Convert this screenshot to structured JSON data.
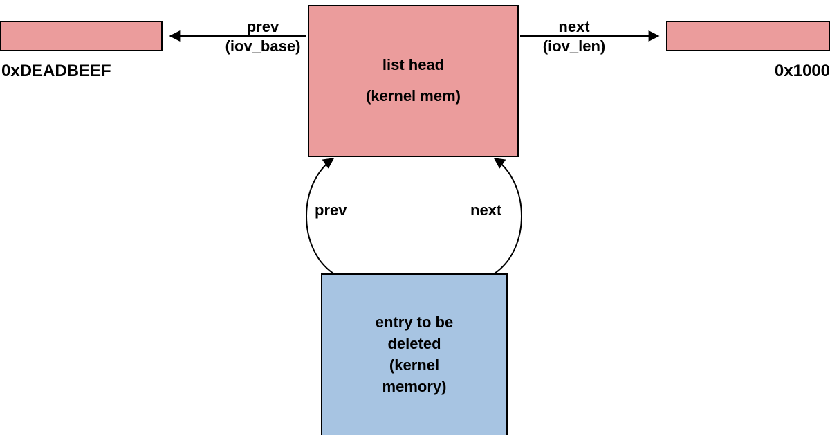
{
  "colors": {
    "pink": "#eb9c9c",
    "blue": "#a7c4e2",
    "stroke": "#000000"
  },
  "left_box": {
    "caption": "0xDEADBEEF"
  },
  "right_box": {
    "caption": "0x1000"
  },
  "center_box": {
    "line1": "list head",
    "line2": "(kernel mem)"
  },
  "bottom_box": {
    "line1": "entry to be",
    "line2": "deleted",
    "line3": "(kernel",
    "line4": "memory)"
  },
  "labels": {
    "prev_top": "prev\n(iov_base)",
    "next_top": "next\n(iov_len)",
    "prev_mid": "prev",
    "next_mid": "next"
  }
}
